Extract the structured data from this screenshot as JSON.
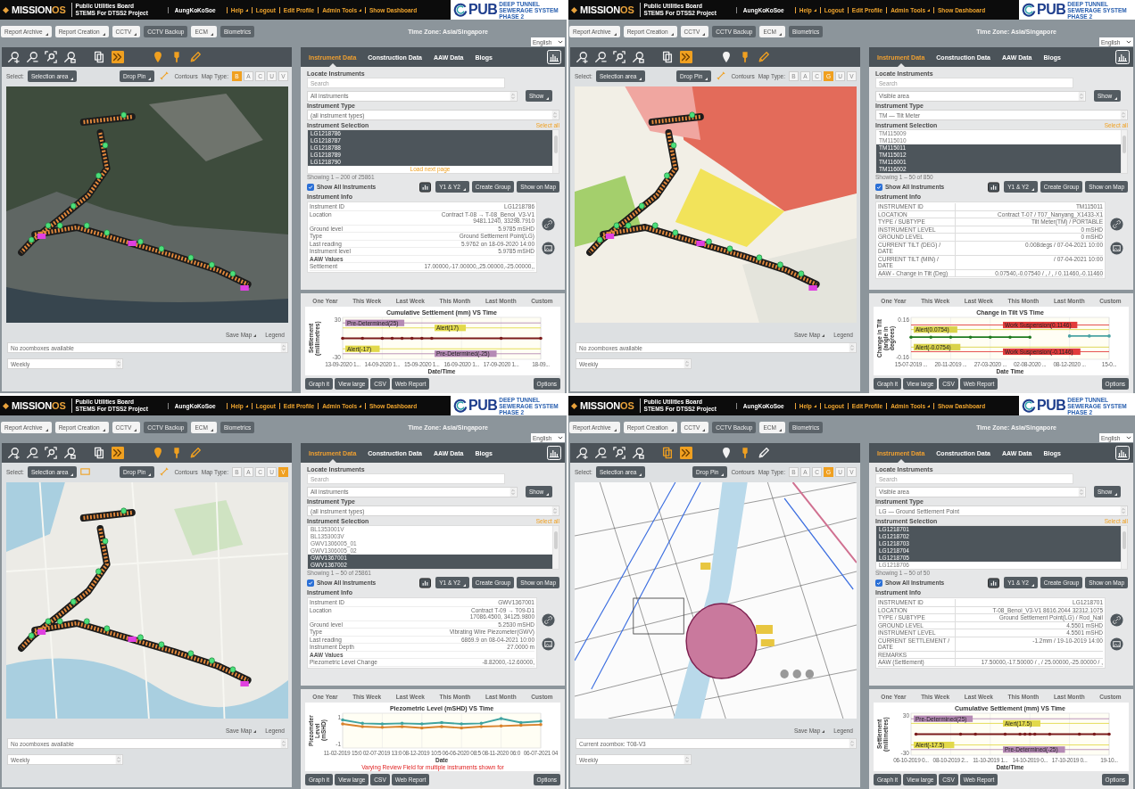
{
  "panels": [
    {
      "header": {
        "logo_text": "MISSION",
        "logo_accent": "OS",
        "org": "Public Utilities Board",
        "project": "STEMS For DTSS2 Project",
        "user": "AungKoKoSoe",
        "links": [
          {
            "label": "Help",
            "dropdown": true
          },
          {
            "label": "Logout",
            "dropdown": false
          },
          {
            "label": "Edit Profile",
            "dropdown": false
          },
          {
            "label": "Admin Tools",
            "dropdown": true
          },
          {
            "label": "Show Dashboard",
            "dropdown": false
          }
        ],
        "brand": "PUB",
        "brand_lines": [
          "DEEP TUNNEL",
          "SEWERAGE SYSTEM",
          "PHASE 2"
        ]
      },
      "toolbar": {
        "buttons": [
          {
            "label": "Report Archive",
            "kind": "menu"
          },
          {
            "label": "Report Creation",
            "kind": "menu"
          },
          {
            "label": "CCTV",
            "kind": "menu"
          },
          {
            "label": "CCTV Backup",
            "kind": "button"
          },
          {
            "label": "ECM",
            "kind": "menu"
          },
          {
            "label": "Biometrics",
            "kind": "button"
          }
        ],
        "timezone": "Time Zone: Asia/Singapore",
        "language": "English"
      },
      "map": {
        "kind": "satellite",
        "tools": [
          {
            "kind": "zoom-in",
            "highlighted": false
          },
          {
            "kind": "zoom-out",
            "highlighted": false
          },
          {
            "kind": "zoom-fit",
            "highlighted": false
          },
          {
            "kind": "zoom-box",
            "highlighted": false
          },
          {
            "kind": "pages",
            "highlighted": false
          },
          {
            "kind": "chevrons",
            "highlighted": true
          },
          {
            "kind": "balloon",
            "highlighted": true
          },
          {
            "kind": "pin",
            "highlighted": true
          },
          {
            "kind": "pencil",
            "highlighted": true
          }
        ],
        "select_label": "Select:",
        "select_value": "Selection area",
        "drop_pin": "Drop Pin",
        "measure_tool": true,
        "contours": "Contours",
        "map_type_label": "Map Type:",
        "map_types": [
          {
            "label": "B",
            "selected": true
          },
          {
            "label": "A",
            "selected": false
          },
          {
            "label": "C",
            "selected": false
          },
          {
            "label": "U",
            "selected": false
          },
          {
            "label": "V",
            "selected": false
          }
        ],
        "save_map": "Save Map",
        "legend": "Legend",
        "zoombox": "No zoomboxes available",
        "period": "Weekly"
      },
      "instrument": {
        "tabs": [
          {
            "label": "Instrument Data",
            "selected": true
          },
          {
            "label": "Construction Data",
            "selected": false
          },
          {
            "label": "AAW Data",
            "selected": false
          },
          {
            "label": "Blogs",
            "selected": false
          }
        ],
        "locate_title": "Locate Instruments",
        "search_placeholder": "Search",
        "scope": "All instruments",
        "show": "Show",
        "type_title": "Instrument Type",
        "type_value": "(all instrument types)",
        "selection_title": "Instrument Selection",
        "select_all": "Select all",
        "items": [
          {
            "label": "LG1218786",
            "selected": true
          },
          {
            "label": "LG1218787",
            "selected": true
          },
          {
            "label": "LG1218788",
            "selected": true
          },
          {
            "label": "LG1218789",
            "selected": true
          },
          {
            "label": "LG1218790",
            "selected": true
          }
        ],
        "load_next": "Load next page",
        "showing": "Showing 1 – 200 of 25861",
        "show_all": {
          "label": "Show All Instruments",
          "checked": true
        },
        "axis_button": "Y1 & Y2",
        "actions": [
          "Create Group",
          "Show on Map"
        ],
        "info_title": "Instrument Info",
        "info": {
          "kind": "plain",
          "rows": [
            {
              "kind": "field",
              "label": "Instrument ID",
              "value": "LG1218786"
            },
            {
              "kind": "field",
              "label": "Location",
              "value": "Contract T-08 → T-08_Benoi_V3-V1\n9481.1240, 33298.7910"
            },
            {
              "kind": "field",
              "label": "Ground level",
              "value": "5.9785 mSHD"
            },
            {
              "kind": "field",
              "label": "Type",
              "value": "Ground Settlement Point(LG)"
            },
            {
              "kind": "field",
              "label": "Last reading",
              "value": "5.9762 on 18-09-2020 14:00"
            },
            {
              "kind": "field",
              "label": "Instrument level",
              "value": "5.9785 mSHD"
            },
            {
              "kind": "heading",
              "label": "AAW Values"
            },
            {
              "kind": "field",
              "label": "Settlement",
              "value": "17.00000,-17.00000,,25.00000,-25.00000,,"
            }
          ]
        }
      },
      "chart": {
        "ranges": [
          "One Year",
          "This Week",
          "Last Week",
          "This Month",
          "Last Month",
          "Custom"
        ],
        "chart_data": {
          "type": "line",
          "title": "Cumulative Settlement (mm) VS Time",
          "xlabel": "Date/Time",
          "ylabel": "Settlement (millimetres)",
          "grid": true,
          "categories": [
            "13-09-2020 1...",
            null,
            null,
            null,
            "14-09-2020 1...",
            null,
            null,
            null,
            "15-09-2020 1...",
            null,
            null,
            null,
            "16-09-2020 1...",
            null,
            null,
            null,
            "17-09-2020 1...",
            null,
            null,
            null,
            "18-09..."
          ],
          "series": [
            {
              "color": "#7b1c1c",
              "values": [
                0,
                null,
                0,
                null,
                0,
                0,
                0,
                0,
                0,
                0,
                null,
                null,
                null,
                null,
                null,
                null,
                0,
                null,
                null,
                null,
                0
              ]
            }
          ],
          "ylim": [
            -34,
            34
          ],
          "yticks": [
            30,
            -30
          ],
          "ref_lines": [
            {
              "axis": "y",
              "value": 25,
              "label": "Pre-Determined(25)",
              "color": "#b58ab5"
            },
            {
              "axis": "y",
              "value": 17,
              "label": "Alert(17)",
              "color": "#e2d94a"
            },
            {
              "axis": "y",
              "value": -17,
              "label": "Alert(-17)",
              "color": "#e2d94a"
            },
            {
              "axis": "y",
              "value": -25,
              "label": "Pre-Determined(-25)",
              "color": "#b58ab5"
            }
          ]
        },
        "buttons": [
          "Graph it",
          "View large",
          "CSV",
          "Web Report"
        ],
        "options": "Options"
      }
    },
    {
      "header": {
        "logo_text": "MISSION",
        "logo_accent": "OS",
        "org": "Public Utilities Board",
        "project": "STEMS For DTSS2 Project",
        "user": "AungKoKoSoe",
        "links": [
          {
            "label": "Help",
            "dropdown": true
          },
          {
            "label": "Logout",
            "dropdown": false
          },
          {
            "label": "Edit Profile",
            "dropdown": false
          },
          {
            "label": "Admin Tools",
            "dropdown": true
          },
          {
            "label": "Show Dashboard",
            "dropdown": false
          }
        ],
        "brand": "PUB",
        "brand_lines": [
          "DEEP TUNNEL",
          "SEWERAGE SYSTEM",
          "PHASE 2"
        ]
      },
      "toolbar": {
        "buttons": [
          {
            "label": "Report Archive",
            "kind": "menu"
          },
          {
            "label": "Report Creation",
            "kind": "menu"
          },
          {
            "label": "CCTV",
            "kind": "menu"
          },
          {
            "label": "CCTV Backup",
            "kind": "button"
          },
          {
            "label": "ECM",
            "kind": "menu"
          },
          {
            "label": "Biometrics",
            "kind": "button"
          }
        ],
        "timezone": "Time Zone: Asia/Singapore",
        "language": "English"
      },
      "map": {
        "kind": "geology",
        "tools": [
          {
            "kind": "zoom-in",
            "highlighted": false
          },
          {
            "kind": "zoom-out",
            "highlighted": false
          },
          {
            "kind": "zoom-fit",
            "highlighted": false
          },
          {
            "kind": "zoom-box",
            "highlighted": false
          },
          {
            "kind": "pages",
            "highlighted": false
          },
          {
            "kind": "chevrons",
            "highlighted": true
          },
          {
            "kind": "balloon",
            "highlighted": false
          },
          {
            "kind": "pin",
            "highlighted": true
          },
          {
            "kind": "pencil",
            "highlighted": true
          }
        ],
        "select_label": "Select:",
        "select_value": "Selection area",
        "drop_pin": "Drop Pin",
        "measure_tool": true,
        "contours": "Contours",
        "map_type_label": "Map Type:",
        "map_types": [
          {
            "label": "B",
            "selected": false
          },
          {
            "label": "A",
            "selected": false
          },
          {
            "label": "C",
            "selected": false
          },
          {
            "label": "G",
            "selected": true
          },
          {
            "label": "U",
            "selected": false
          },
          {
            "label": "V",
            "selected": false
          }
        ],
        "save_map": "Save Map",
        "legend": "Legend",
        "zoombox": "No zoomboxes available",
        "period": "Weekly"
      },
      "instrument": {
        "tabs": [
          {
            "label": "Instrument Data",
            "selected": true
          },
          {
            "label": "Construction Data",
            "selected": false
          },
          {
            "label": "AAW Data",
            "selected": false
          },
          {
            "label": "Blogs",
            "selected": false
          }
        ],
        "locate_title": "Locate Instruments",
        "search_placeholder": "Search",
        "scope": "Visible area",
        "show": "Show",
        "type_title": "Instrument Type",
        "type_value": "TM — Tilt Meter",
        "selection_title": "Instrument Selection",
        "select_all": "Select all",
        "items": [
          {
            "label": "TM115009",
            "selected": false
          },
          {
            "label": "TM115010",
            "selected": false
          },
          {
            "label": "TM115011",
            "selected": true
          },
          {
            "label": "TM115012",
            "selected": true
          },
          {
            "label": "TM116001",
            "selected": true
          },
          {
            "label": "TM116002",
            "selected": true
          }
        ],
        "showing": "Showing 1 – 50 of 850",
        "show_all": {
          "label": "Show All Instruments",
          "checked": true
        },
        "axis_button": "Y1 & Y2",
        "actions": [
          "Create Group",
          "Show on Map"
        ],
        "info_title": "Instrument Info",
        "info": {
          "kind": "grid",
          "rows": [
            {
              "kind": "field",
              "label": "INSTRUMENT ID",
              "value": "TM115011"
            },
            {
              "kind": "field",
              "label": "LOCATION",
              "value": "Contract T-07 / T07_Nanyang_X1433-X1"
            },
            {
              "kind": "field",
              "label": "TYPE / SUBTYPE",
              "value": "Tilt Meter(TM) / PORTABLE"
            },
            {
              "kind": "field",
              "label": "INSTRUMENT LEVEL",
              "value": "0 mSHD"
            },
            {
              "kind": "field",
              "label": "GROUND LEVEL",
              "value": "0 mSHD"
            },
            {
              "kind": "field",
              "label": "CURRENT TILT (DEG) / DATE",
              "value": "0.008degs / 07-04-2021 10:00"
            },
            {
              "kind": "field",
              "label": "CURRENT TILT (MIN) / DATE",
              "value": "/ 07-04-2021 10:00"
            },
            {
              "kind": "field",
              "label": "AAW - Change in Tilt (Deg)",
              "value": "0.07540,-0.07540 / , / , / 0.11460,-0.11460"
            }
          ]
        }
      },
      "chart": {
        "ranges": [
          "One Year",
          "This Week",
          "Last Week",
          "This Month",
          "Last Month",
          "Custom"
        ],
        "chart_data": {
          "type": "line",
          "title": "Change in Tilt VS Time",
          "xlabel": "Date Time",
          "ylabel": "Change in Tilt (angle in degrees)",
          "grid": true,
          "categories": [
            "15-07-2019 ...",
            null,
            "20-11-2019 ...",
            null,
            "27-03-2020 ...",
            null,
            "02-08-2020 ...",
            null,
            "08-12-2020 ...",
            null,
            "15-0..."
          ],
          "series": [
            {
              "color": "#1f7a1f",
              "values": [
                0.01,
                0.01,
                0.01,
                0.01,
                0.01,
                0.01,
                0.01,
                null,
                null,
                null,
                null
              ]
            },
            {
              "color": "#4aa3a3",
              "values": [
                null,
                null,
                null,
                null,
                null,
                null,
                null,
                null,
                0.02,
                0.02,
                0.02
              ]
            }
          ],
          "ylim": [
            -0.18,
            0.18
          ],
          "yticks": [
            0.16,
            -0.16
          ],
          "ref_lines": [
            {
              "axis": "y",
              "value": 0.0754,
              "label": "Alert(0.0754)",
              "color": "#d9d24a"
            },
            {
              "axis": "y",
              "value": 0.1146,
              "label": "Work Suspension(0.1146)",
              "color": "#e23c3c"
            },
            {
              "axis": "y",
              "value": -0.0754,
              "label": "Alert(-0.0754)",
              "color": "#d9d24a"
            },
            {
              "axis": "y",
              "value": -0.1146,
              "label": "Work Suspension(-0.1146)",
              "color": "#e23c3c"
            }
          ]
        },
        "buttons": [
          "Graph it",
          "View large",
          "CSV",
          "Web Report"
        ],
        "options": "Options"
      }
    },
    {
      "header": {
        "logo_text": "MISSION",
        "logo_accent": "OS",
        "org": "Public Utilities Board",
        "project": "STEMS For DTSS2 Project",
        "user": "AungKoKoSoe",
        "links": [
          {
            "label": "Help",
            "dropdown": true
          },
          {
            "label": "Logout",
            "dropdown": false
          },
          {
            "label": "Edit Profile",
            "dropdown": false
          },
          {
            "label": "Admin Tools",
            "dropdown": true
          },
          {
            "label": "Show Dashboard",
            "dropdown": false
          }
        ],
        "brand": "PUB",
        "brand_lines": [
          "DEEP TUNNEL",
          "SEWERAGE SYSTEM",
          "PHASE 2"
        ]
      },
      "toolbar": {
        "buttons": [
          {
            "label": "Report Archive",
            "kind": "menu"
          },
          {
            "label": "Report Creation",
            "kind": "menu"
          },
          {
            "label": "CCTV",
            "kind": "menu"
          },
          {
            "label": "CCTV Backup",
            "kind": "button"
          },
          {
            "label": "ECM",
            "kind": "menu"
          },
          {
            "label": "Biometrics",
            "kind": "button"
          }
        ],
        "timezone": "Time Zone: Asia/Singapore",
        "language": "English"
      },
      "map": {
        "kind": "street",
        "tools": [
          {
            "kind": "zoom-in",
            "highlighted": false
          },
          {
            "kind": "zoom-out",
            "highlighted": false
          },
          {
            "kind": "zoom-fit",
            "highlighted": false
          },
          {
            "kind": "zoom-box",
            "highlighted": false
          },
          {
            "kind": "pages",
            "highlighted": false
          },
          {
            "kind": "chevrons",
            "highlighted": true
          },
          {
            "kind": "balloon",
            "highlighted": true
          },
          {
            "kind": "pin",
            "highlighted": true
          },
          {
            "kind": "pencil",
            "highlighted": true
          }
        ],
        "select_label": "Select:",
        "select_value": "Selection area",
        "rect_tool": true,
        "drop_pin": "Drop Pin",
        "measure_tool": true,
        "contours": "Contours",
        "map_type_label": "Map Type:",
        "map_types": [
          {
            "label": "B",
            "selected": false
          },
          {
            "label": "A",
            "selected": false
          },
          {
            "label": "C",
            "selected": false
          },
          {
            "label": "U",
            "selected": false
          },
          {
            "label": "V",
            "selected": true
          }
        ],
        "save_map": "Save Map",
        "legend": "Legend",
        "zoombox": "No zoomboxes available",
        "period": "Weekly"
      },
      "instrument": {
        "tabs": [
          {
            "label": "Instrument Data",
            "selected": true
          },
          {
            "label": "Construction Data",
            "selected": false
          },
          {
            "label": "AAW Data",
            "selected": false
          },
          {
            "label": "Blogs",
            "selected": false
          }
        ],
        "locate_title": "Locate Instruments",
        "search_placeholder": "Search",
        "scope": "All instruments",
        "show": "Show",
        "type_title": "Instrument Type",
        "type_value": "(all instrument types)",
        "selection_title": "Instrument Selection",
        "select_all": "Select all",
        "items": [
          {
            "label": "BL1353001V",
            "selected": false
          },
          {
            "label": "BL1353003V",
            "selected": false
          },
          {
            "label": "GWV1306005_01",
            "selected": false
          },
          {
            "label": "GWV1306005_02",
            "selected": false
          },
          {
            "label": "GWV1367001",
            "selected": true
          },
          {
            "label": "GWV1367002",
            "selected": true
          }
        ],
        "showing": "Showing 1 – 50 of 25861",
        "show_all": {
          "label": "Show All Instruments",
          "checked": true
        },
        "axis_button": "Y1 & Y2",
        "actions": [
          "Create Group",
          "Show on Map"
        ],
        "info_title": "Instrument Info",
        "info": {
          "kind": "plain",
          "rows": [
            {
              "kind": "field",
              "label": "Instrument ID",
              "value": "GWV1367001"
            },
            {
              "kind": "field",
              "label": "Location",
              "value": "Contract T-09 → T09-D1\n17086.4500, 34125.9800"
            },
            {
              "kind": "field",
              "label": "Ground level",
              "value": "5.2530 mSHD"
            },
            {
              "kind": "field",
              "label": "Type",
              "value": "Vibrating Wire Piezometer(GWV)"
            },
            {
              "kind": "field",
              "label": "Last reading",
              "value": "6869.9 on 08-04-2021 10:00"
            },
            {
              "kind": "field",
              "label": "Instrument Depth",
              "value": "27.0000 m"
            },
            {
              "kind": "heading",
              "label": "AAW Values"
            },
            {
              "kind": "field",
              "label": "Piezometric Level Change",
              "value": "-8.82000,-12.60000,"
            }
          ]
        }
      },
      "chart": {
        "ranges": [
          "One Year",
          "This Week",
          "Last Week",
          "This Month",
          "Last Month",
          "Custom"
        ],
        "chart_data": {
          "type": "line",
          "title": "Piezometric Level (mSHD) VS Time",
          "xlabel": "Date",
          "ylabel": "Piezometer Level (mSHD)",
          "grid": true,
          "categories": [
            "11-02-2019 15:0",
            null,
            "02-07-2019 13:0",
            null,
            "08-12-2019 10:5",
            null,
            "06-06-2020 08:5",
            null,
            "08-11-2020 06:0",
            null,
            "06-07-2021 04"
          ],
          "series": [
            {
              "color": "#3fa3a0",
              "values": [
                0.8,
                0.55,
                0.5,
                0.55,
                0.5,
                0.6,
                0.5,
                0.55,
                0.9,
                0.6,
                0.7
              ]
            },
            {
              "color": "#d9822b",
              "values": [
                0.5,
                0.3,
                0.25,
                0.3,
                0.2,
                0.3,
                0.2,
                0.3,
                0.35,
                0.4,
                0.45
              ]
            }
          ],
          "ylim": [
            -1.3,
            1.3
          ],
          "yticks": [
            1,
            -1
          ]
        },
        "note": "Varying Review Field for multiple instruments shown for",
        "buttons": [
          "Graph it",
          "View large",
          "CSV",
          "Web Report"
        ],
        "options": "Options"
      }
    },
    {
      "header": {
        "logo_text": "MISSION",
        "logo_accent": "OS",
        "org": "Public Utilities Board",
        "project": "STEMS For DTSS2 Project",
        "user": "AungKoKoSoe",
        "links": [
          {
            "label": "Help",
            "dropdown": true
          },
          {
            "label": "Logout",
            "dropdown": false
          },
          {
            "label": "Edit Profile",
            "dropdown": false
          },
          {
            "label": "Admin Tools",
            "dropdown": true
          },
          {
            "label": "Show Dashboard",
            "dropdown": false
          }
        ],
        "brand": "PUB",
        "brand_lines": [
          "DEEP TUNNEL",
          "SEWERAGE SYSTEM",
          "PHASE 2"
        ]
      },
      "toolbar": {
        "buttons": [
          {
            "label": "Report Archive",
            "kind": "menu"
          },
          {
            "label": "Report Creation",
            "kind": "menu"
          },
          {
            "label": "CCTV",
            "kind": "menu"
          },
          {
            "label": "CCTV Backup",
            "kind": "button"
          },
          {
            "label": "ECM",
            "kind": "menu"
          },
          {
            "label": "Biometrics",
            "kind": "button"
          }
        ],
        "timezone": "Time Zone: Asia/Singapore",
        "language": "English"
      },
      "map": {
        "kind": "site-plan",
        "tools": [
          {
            "kind": "zoom-in",
            "highlighted": false
          },
          {
            "kind": "zoom-out",
            "highlighted": false
          },
          {
            "kind": "zoom-fit",
            "highlighted": false
          },
          {
            "kind": "zoom-box",
            "highlighted": false
          },
          {
            "kind": "pages",
            "highlighted": true
          },
          {
            "kind": "chevrons",
            "highlighted": true
          },
          {
            "kind": "balloon",
            "highlighted": false
          },
          {
            "kind": "pin",
            "highlighted": true
          },
          {
            "kind": "pencil",
            "highlighted": false
          }
        ],
        "select_label": "Select:",
        "select_value": "Selection area",
        "drop_pin": "Drop Pin",
        "contours": "Contours",
        "map_type_label": "Map Type:",
        "map_types": [
          {
            "label": "B",
            "selected": false
          },
          {
            "label": "A",
            "selected": false
          },
          {
            "label": "C",
            "selected": false
          },
          {
            "label": "G",
            "selected": true
          },
          {
            "label": "U",
            "selected": false
          },
          {
            "label": "V",
            "selected": false
          }
        ],
        "save_map": "Save Map",
        "legend": "Legend",
        "zoombox": "Current zoombox: T08-V3",
        "period": "Weekly"
      },
      "instrument": {
        "tabs": [
          {
            "label": "Instrument Data",
            "selected": true
          },
          {
            "label": "Construction Data",
            "selected": false
          },
          {
            "label": "AAW Data",
            "selected": false
          },
          {
            "label": "Blogs",
            "selected": false
          }
        ],
        "locate_title": "Locate Instruments",
        "search_placeholder": "Search",
        "scope": "Visible area",
        "show": "Show",
        "type_title": "Instrument Type",
        "type_value": "LG — Ground Settlement Point",
        "selection_title": "Instrument Selection",
        "select_all": "Select all",
        "items": [
          {
            "label": "LG1218701",
            "selected": true
          },
          {
            "label": "LG1218702",
            "selected": true
          },
          {
            "label": "LG1218703",
            "selected": true
          },
          {
            "label": "LG1218704",
            "selected": true
          },
          {
            "label": "LG1218705",
            "selected": true
          },
          {
            "label": "LG1218706",
            "selected": false
          }
        ],
        "showing": "Showing 1 – 50 of 50",
        "show_all": {
          "label": "Show All Instruments",
          "checked": true
        },
        "axis_button": "Y1 & Y2",
        "actions": [
          "Create Group",
          "Show on Map"
        ],
        "info_title": "Instrument Info",
        "info": {
          "kind": "grid",
          "rows": [
            {
              "kind": "field",
              "label": "INSTRUMENT ID",
              "value": "LG1218701"
            },
            {
              "kind": "field",
              "label": "LOCATION",
              "value": "T-08_Benoi_V3-V1  8616.2044  32312.1075"
            },
            {
              "kind": "field",
              "label": "TYPE / SUBTYPE",
              "value": "Ground Settlement Point(LG) / Rod_Nail"
            },
            {
              "kind": "field",
              "label": "GROUND LEVEL",
              "value": "4.5501 mSHD"
            },
            {
              "kind": "field",
              "label": "INSTRUMENT LEVEL",
              "value": "4.5501 mSHD"
            },
            {
              "kind": "field",
              "label": "CURRENT SETTLEMENT / DATE",
              "value": "-1.2mm / 19-10-2019 14:00"
            },
            {
              "kind": "field",
              "label": "REMARKS"
            },
            {
              "kind": "field",
              "label": "AAW (Settlement)",
              "value": "17.50000,-17.50000 / , / 25.00000,-25.00000 / ,"
            }
          ]
        }
      },
      "chart": {
        "ranges": [
          "One Year",
          "This Week",
          "Last Week",
          "This Month",
          "Last Month",
          "Custom"
        ],
        "chart_data": {
          "type": "line",
          "title": "Cumulative Settlement (mm) VS Time",
          "xlabel": "Date/Time",
          "ylabel": "Settlement (millimetres)",
          "grid": true,
          "categories": [
            "06-10-2019 0...",
            null,
            null,
            null,
            null,
            null,
            null,
            null,
            "08-10-2019 2...",
            null,
            null,
            null,
            null,
            null,
            null,
            null,
            "11-10-2019 1...",
            null,
            null,
            null,
            null,
            null,
            null,
            null,
            "14-10-2019 0...",
            null,
            null,
            null,
            null,
            null,
            null,
            null,
            "17-10-2019 0...",
            null,
            null,
            null,
            null,
            null,
            null,
            null,
            "19-10..."
          ],
          "series": [
            {
              "color": "#7b1c1c",
              "values": [
                null,
                0,
                null,
                null,
                null,
                null,
                null,
                null,
                null,
                null,
                0,
                null,
                null,
                0,
                null,
                null,
                null,
                null,
                null,
                0,
                null,
                null,
                0,
                0,
                0,
                0,
                null,
                null,
                0,
                null,
                null,
                null,
                null,
                null,
                0,
                null,
                null,
                0,
                null,
                null,
                0
              ]
            }
          ],
          "ylim": [
            -34,
            34
          ],
          "yticks": [
            30,
            -30
          ],
          "ref_lines": [
            {
              "axis": "y",
              "value": 25,
              "label": "Pre-Determined(25)",
              "color": "#b58ab5"
            },
            {
              "axis": "y",
              "value": 17.5,
              "label": "Alert(17.5)",
              "color": "#e2d94a"
            },
            {
              "axis": "y",
              "value": -17.5,
              "label": "Alert(-17.5)",
              "color": "#e2d94a"
            },
            {
              "axis": "y",
              "value": -25,
              "label": "Pre-Determined(-25)",
              "color": "#b58ab5"
            }
          ]
        },
        "buttons": [
          "Graph it",
          "View large",
          "CSV",
          "Web Report"
        ],
        "options": "Options"
      }
    }
  ]
}
